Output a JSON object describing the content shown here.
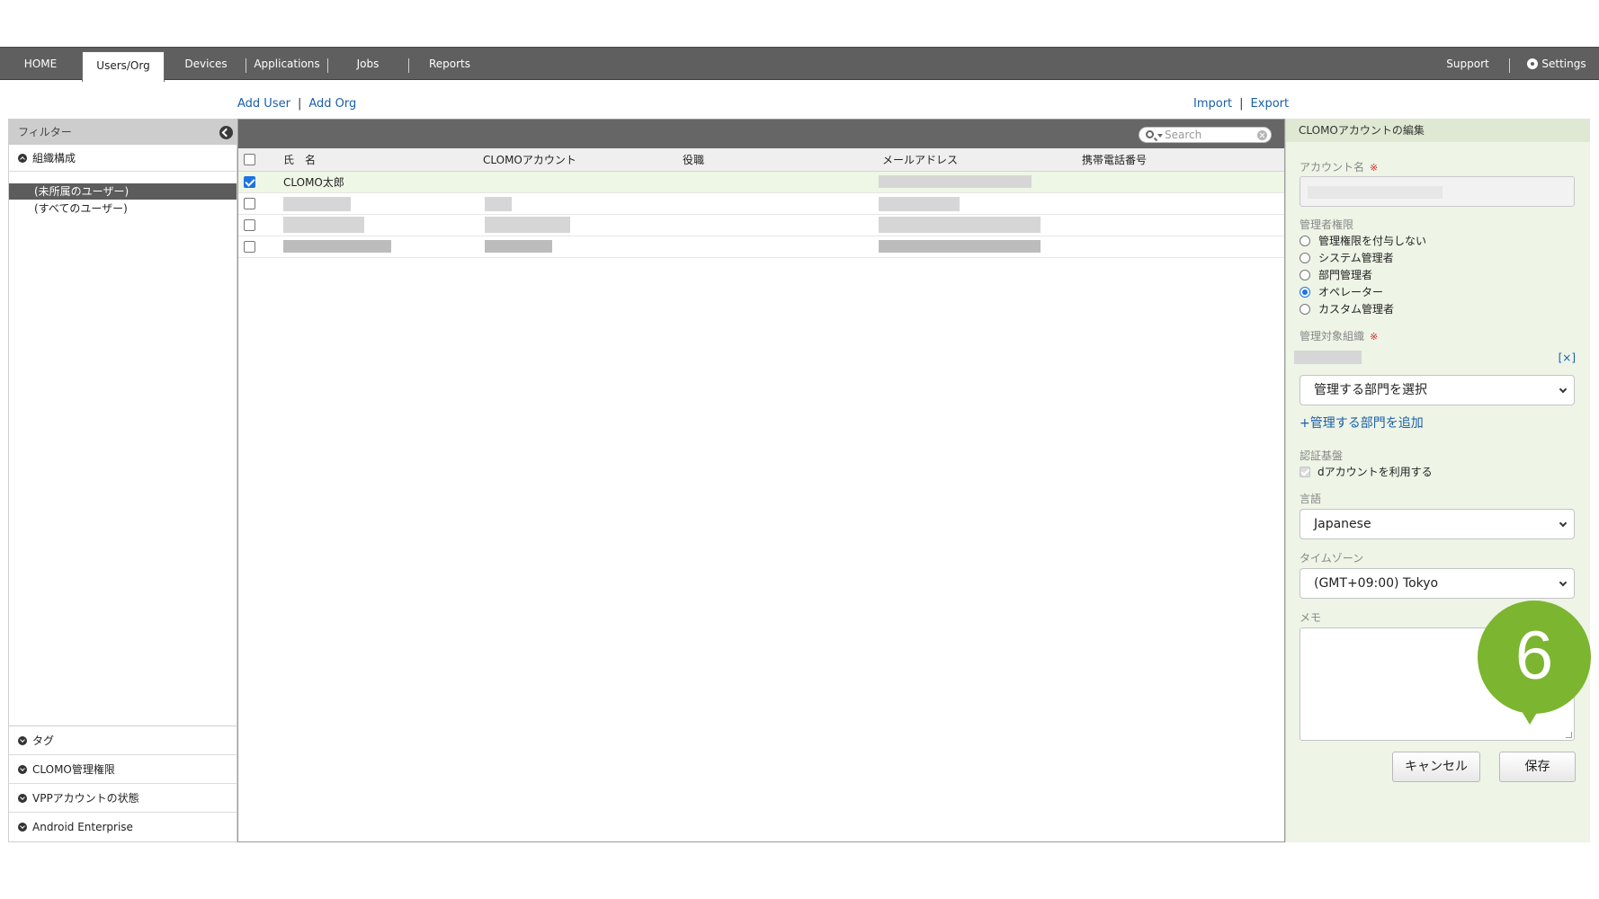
{
  "nav": {
    "home": "HOME",
    "users_org": "Users/Org",
    "devices": "Devices",
    "applications": "Applications",
    "jobs": "Jobs",
    "reports": "Reports",
    "support": "Support",
    "settings": "Settings"
  },
  "actions": {
    "add_user": "Add User",
    "add_org": "Add Org",
    "import": "Import",
    "export": "Export",
    "separator": "|"
  },
  "sidebar": {
    "header": "フィルター",
    "org_section": "組織構成",
    "tree": [
      "(未所属のユーザー)",
      "(すべてのユーザー)"
    ],
    "bottom_sections": [
      "タグ",
      "CLOMO管理権限",
      "VPPアカウントの状態",
      "Android Enterprise"
    ]
  },
  "table": {
    "search_placeholder": "Search",
    "columns": {
      "name": "氏　名",
      "account": "CLOMOアカウント",
      "title": "役職",
      "email": "メールアドレス",
      "phone": "携帯電話番号"
    },
    "first_row_name": "CLOMO太郎"
  },
  "panel": {
    "title": "CLOMOアカウントの編集",
    "account_label": "アカウント名",
    "required_mark": "※",
    "admin_label": "管理者権限",
    "roles": [
      "管理権限を付与しない",
      "システム管理者",
      "部門管理者",
      "オペレーター",
      "カスタム管理者"
    ],
    "selected_role": "オペレーター",
    "target_org_label": "管理対象組織",
    "remove": "[×]",
    "dept_select": "管理する部門を選択",
    "add_dept": "+管理する部門を追加",
    "auth_label": "認証基盤",
    "d_account": "dアカウントを利用する",
    "lang_label": "言語",
    "lang_value": "Japanese",
    "tz_label": "タイムゾーン",
    "tz_value": "(GMT+09:00) Tokyo",
    "memo_label": "メモ",
    "cancel": "キャンセル",
    "save": "保存"
  },
  "marker": {
    "step": "6"
  },
  "colors": {
    "nav_bg": "#5f5f5f",
    "link": "#1a5fa8",
    "panel_bg": "#eef4e6",
    "marker": "#7cb52f",
    "check": "#1c74e3",
    "required": "#d62a2a"
  }
}
